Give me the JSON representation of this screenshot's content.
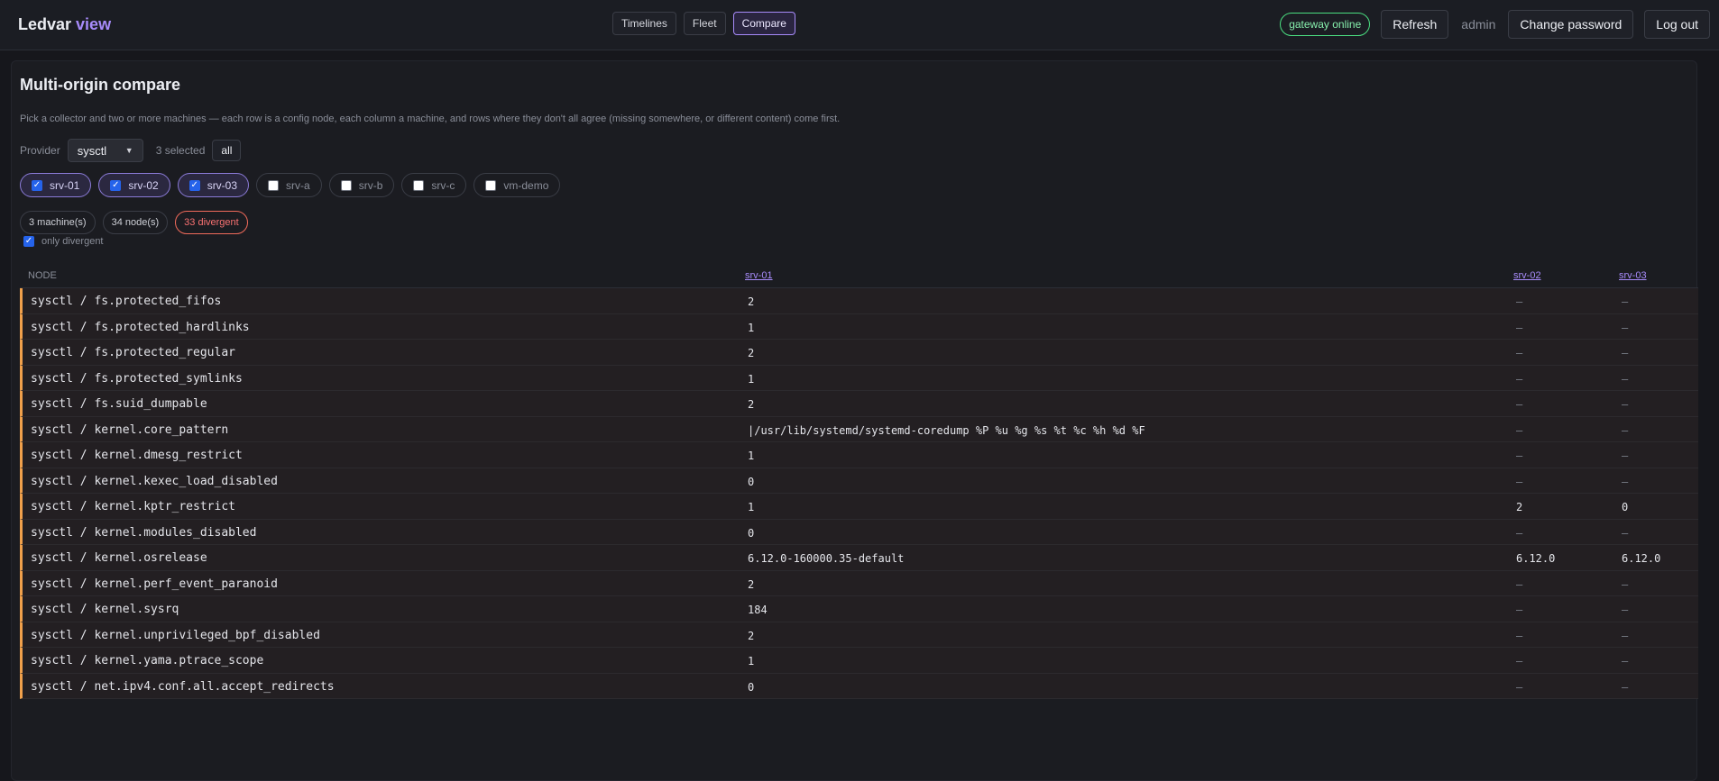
{
  "app": {
    "brand": "Ledvar",
    "brand_accent": "view"
  },
  "nav": {
    "tabs": [
      "Timelines",
      "Fleet",
      "Compare"
    ],
    "active": "Compare"
  },
  "header": {
    "status": "gateway online",
    "refresh": "Refresh",
    "user": "admin",
    "change_password": "Change password",
    "logout": "Log out"
  },
  "page": {
    "title": "Multi-origin compare",
    "description": "Pick a collector and two or more machines — each row is a config node, each column a machine, and rows where they don't all agree (missing somewhere, or different content) come first.",
    "provider_label": "Provider",
    "provider_value": "sysctl",
    "selected_text": "3 selected",
    "all_button": "all"
  },
  "machines": [
    {
      "name": "srv-01",
      "checked": true
    },
    {
      "name": "srv-02",
      "checked": true
    },
    {
      "name": "srv-03",
      "checked": true
    },
    {
      "name": "srv-a",
      "checked": false
    },
    {
      "name": "srv-b",
      "checked": false
    },
    {
      "name": "srv-c",
      "checked": false
    },
    {
      "name": "vm-demo",
      "checked": false
    }
  ],
  "stats": {
    "machines": "3 machine(s)",
    "nodes": "34 node(s)",
    "divergent": "33 divergent"
  },
  "filter": {
    "only_divergent_label": "only divergent",
    "only_divergent": true
  },
  "table": {
    "headers": {
      "node": "NODE",
      "col1": "srv-01",
      "col2": "srv-02",
      "col3": "srv-03"
    },
    "rows": [
      {
        "node": "sysctl / fs.protected_fifos",
        "v1": "2",
        "v2": "—",
        "v3": "—"
      },
      {
        "node": "sysctl / fs.protected_hardlinks",
        "v1": "1",
        "v2": "—",
        "v3": "—"
      },
      {
        "node": "sysctl / fs.protected_regular",
        "v1": "2",
        "v2": "—",
        "v3": "—"
      },
      {
        "node": "sysctl / fs.protected_symlinks",
        "v1": "1",
        "v2": "—",
        "v3": "—"
      },
      {
        "node": "sysctl / fs.suid_dumpable",
        "v1": "2",
        "v2": "—",
        "v3": "—"
      },
      {
        "node": "sysctl / kernel.core_pattern",
        "v1": "|/usr/lib/systemd/systemd-coredump %P %u %g %s %t %c %h %d %F",
        "v2": "—",
        "v3": "—"
      },
      {
        "node": "sysctl / kernel.dmesg_restrict",
        "v1": "1",
        "v2": "—",
        "v3": "—"
      },
      {
        "node": "sysctl / kernel.kexec_load_disabled",
        "v1": "0",
        "v2": "—",
        "v3": "—"
      },
      {
        "node": "sysctl / kernel.kptr_restrict",
        "v1": "1",
        "v2": "2",
        "v3": "0"
      },
      {
        "node": "sysctl / kernel.modules_disabled",
        "v1": "0",
        "v2": "—",
        "v3": "—"
      },
      {
        "node": "sysctl / kernel.osrelease",
        "v1": "6.12.0-160000.35-default",
        "v2": "6.12.0",
        "v3": "6.12.0"
      },
      {
        "node": "sysctl / kernel.perf_event_paranoid",
        "v1": "2",
        "v2": "—",
        "v3": "—"
      },
      {
        "node": "sysctl / kernel.sysrq",
        "v1": "184",
        "v2": "—",
        "v3": "—"
      },
      {
        "node": "sysctl / kernel.unprivileged_bpf_disabled",
        "v1": "2",
        "v2": "—",
        "v3": "—"
      },
      {
        "node": "sysctl / kernel.yama.ptrace_scope",
        "v1": "1",
        "v2": "—",
        "v3": "—"
      },
      {
        "node": "sysctl / net.ipv4.conf.all.accept_redirects",
        "v1": "0",
        "v2": "—",
        "v3": "—"
      }
    ]
  },
  "colors": {
    "accent": "#a78bfa",
    "online": "#4ade80",
    "divergent": "#f87171",
    "row_marker": "#f0a04b"
  }
}
